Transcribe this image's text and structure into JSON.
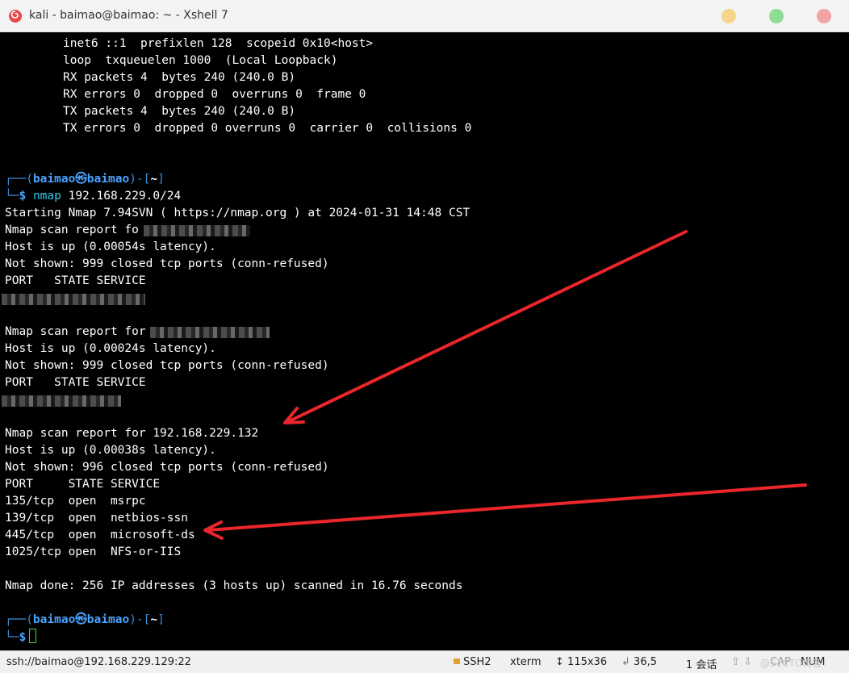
{
  "window": {
    "title": "kali - baimao@baimao: ~ - Xshell 7",
    "colors": {
      "minimize": "#f4d58a",
      "maximize": "#8fdc94",
      "close": "#f3a3a3"
    }
  },
  "terminal": {
    "ifconfig_lines": [
      "inet6 ::1  prefixlen 128  scopeid 0x10<host>",
      "loop  txqueuelen 1000  (Local Loopback)",
      "RX packets 4  bytes 240 (240.0 B)",
      "RX errors 0  dropped 0  overruns 0  frame 0",
      "TX packets 4  bytes 240 (240.0 B)",
      "TX errors 0  dropped 0 overruns 0  carrier 0  collisions 0"
    ],
    "prompt": {
      "open": "┌──(",
      "user_host": "baimao㉿baimao",
      "mid": ")-[",
      "dir": "~",
      "close": "]",
      "second_line": "└─",
      "dollar": "$"
    },
    "command": {
      "name": "nmap",
      "args": " 192.168.229.0/24"
    },
    "scan_lines": {
      "starting": "Starting Nmap 7.94SVN ( https://nmap.org ) at 2024-01-31 14:48 CST",
      "host1_report": "Nmap scan report fo",
      "host1_up": "Host is up (0.00054s latency).",
      "host1_notshown": "Not shown: 999 closed tcp ports (conn-refused)",
      "host1_header": "PORT   STATE SERVICE",
      "host2_report": "Nmap scan report for",
      "host2_up": "Host is up (0.00024s latency).",
      "host2_notshown": "Not shown: 999 closed tcp ports (conn-refused)",
      "host2_header": "PORT   STATE SERVICE",
      "host3_report": "Nmap scan report for 192.168.229.132",
      "host3_up": "Host is up (0.00038s latency).",
      "host3_notshown": "Not shown: 996 closed tcp ports (conn-refused)",
      "host3_header": "PORT     STATE SERVICE",
      "port1": "135/tcp  open  msrpc",
      "port2": "139/tcp  open  netbios-ssn",
      "port3": "445/tcp  open  microsoft-ds",
      "port4": "1025/tcp open  NFS-or-IIS",
      "done": "Nmap done: 256 IP addresses (3 hosts up) scanned in 16.76 seconds"
    },
    "colors": {
      "background": "#000000",
      "text": "#ffffff",
      "prompt_frame": "#3c8dd6",
      "prompt_user": "#4aa3ff",
      "command": "#32c8e6",
      "cursor": "#3ce23c",
      "annotation_arrow": "#e8262b"
    }
  },
  "statusbar": {
    "connection": "ssh://baimao@192.168.229.129:22",
    "protocol": "SSH2",
    "terminal_type": "xterm",
    "size_icon": "↕",
    "size": "115x36",
    "cursor_pos": "36,5",
    "sessions": "1 会话",
    "cap": "CAP",
    "num": "NUM",
    "watermark": "@51CTO博客"
  }
}
